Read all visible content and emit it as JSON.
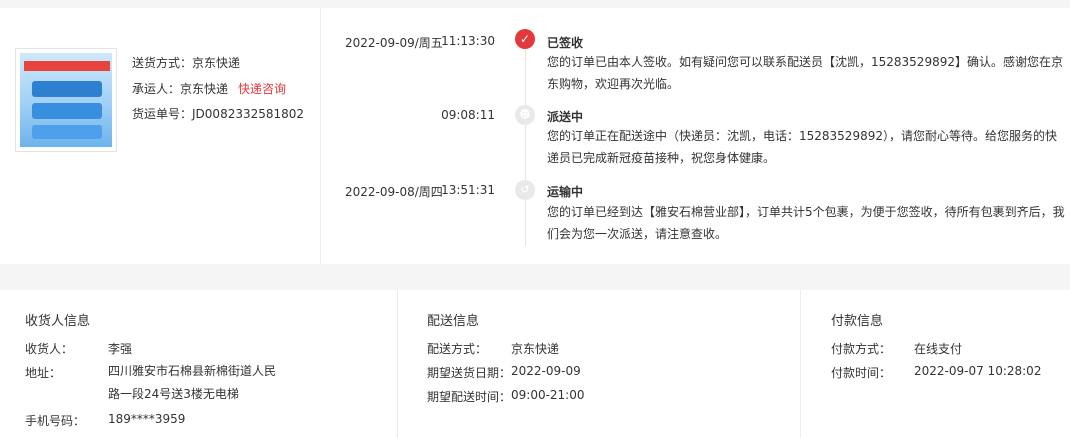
{
  "shipment": {
    "delivery_method_label": "送货方式：",
    "delivery_method_value": "京东快递",
    "carrier_label": "承运人：",
    "carrier_value": "京东快递",
    "carrier_link": "快递咨询",
    "tracking_label": "货运单号：",
    "tracking_value": "JD0082332581802"
  },
  "timeline": [
    {
      "date": "2022-09-09/周五",
      "time": "11:13:30",
      "status": "已签收",
      "icon": "check-icon",
      "text": "您的订单已由本人签收。如有疑问您可以联系配送员【沈凯，15283529892】确认。感谢您在京东购物，欢迎再次光临。"
    },
    {
      "date": "",
      "time": "09:08:11",
      "status": "派送中",
      "icon": "courier-icon",
      "text": "您的订单正在配送途中（快递员：沈凯，电话：15283529892），请您耐心等待。给您服务的快递员已完成新冠疫苗接种，祝您身体健康。"
    },
    {
      "date": "2022-09-08/周四",
      "time": "13:51:31",
      "status": "运输中",
      "icon": "truck-icon",
      "text": "您的订单已经到达【雅安石棉营业部】，订单共计5个包裹，为便于您签收，待所有包裹到齐后，我们会为您一次派送，请注意查收。"
    }
  ],
  "receiver": {
    "title": "收货人信息",
    "name_label": "收货人：",
    "name_value": "李强",
    "address_label": "地址：",
    "address_value": "四川雅安市石棉县新棉街道人民路一段24号送3楼无电梯",
    "phone_label": "手机号码：",
    "phone_value": "189****3959"
  },
  "delivery": {
    "title": "配送信息",
    "method_label": "配送方式：",
    "method_value": "京东快递",
    "date_label": "期望送货日期：",
    "date_value": "2022-09-09",
    "time_label": "期望配送时间：",
    "time_value": "09:00-21:00"
  },
  "payment": {
    "title": "付款信息",
    "method_label": "付款方式：",
    "method_value": "在线支付",
    "time_label": "付款时间：",
    "time_value": "2022-09-07 10:28:02"
  },
  "colors": {
    "accent": "#e4393c",
    "background": "#f5f5f5"
  }
}
